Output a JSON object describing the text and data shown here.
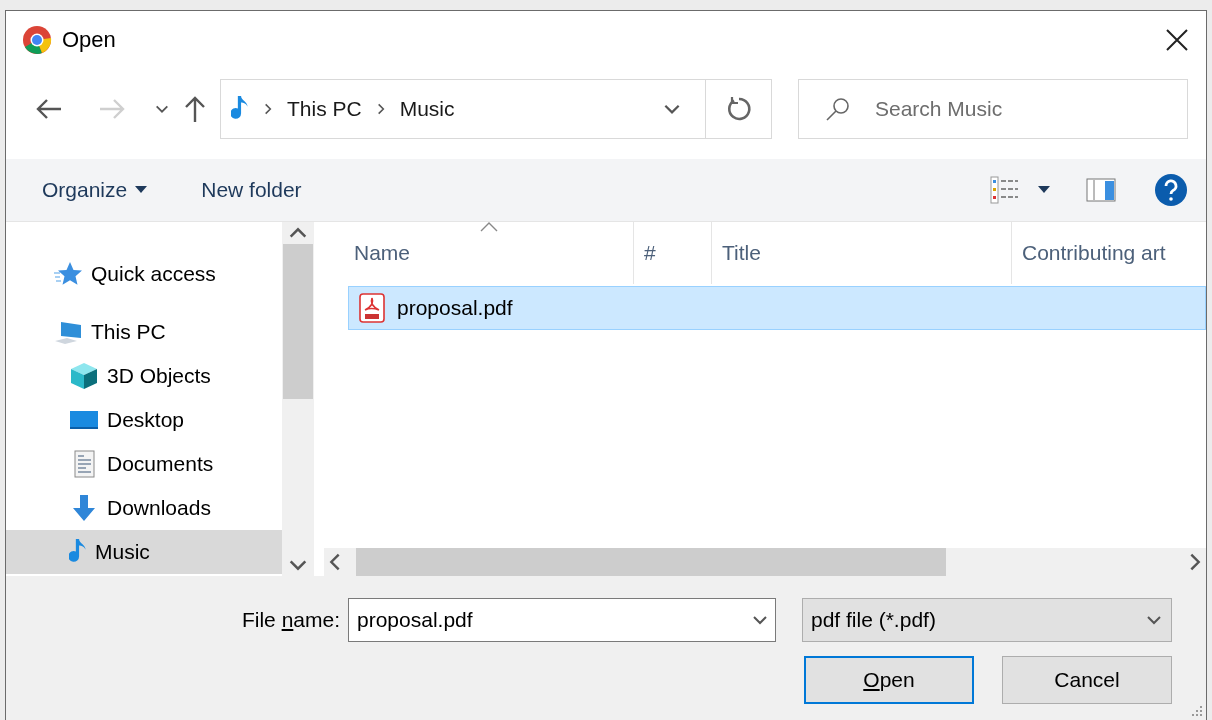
{
  "window": {
    "title": "Open"
  },
  "nav": {
    "buttons": [
      {
        "kind": "back",
        "disabled": false
      },
      {
        "kind": "forward",
        "disabled": true
      },
      {
        "kind": "recent",
        "disabled": false
      },
      {
        "kind": "up",
        "disabled": false
      }
    ],
    "breadcrumbs": [
      "This PC",
      "Music"
    ],
    "search": {
      "placeholder": "Search Music"
    }
  },
  "toolbar": {
    "organize": "Organize",
    "new_folder": "New folder"
  },
  "sidebar": {
    "items": [
      {
        "label": "Quick access",
        "kind": "star",
        "selected": false
      },
      {
        "label": "This PC",
        "kind": "computer",
        "selected": false,
        "children": [
          {
            "label": "3D Objects",
            "kind": "cube",
            "selected": false
          },
          {
            "label": "Desktop",
            "kind": "desktop",
            "selected": false
          },
          {
            "label": "Documents",
            "kind": "document",
            "selected": false
          },
          {
            "label": "Downloads",
            "kind": "download",
            "selected": false
          },
          {
            "label": "Music",
            "kind": "music",
            "selected": true
          }
        ]
      }
    ]
  },
  "table": {
    "columns": [
      {
        "label": "Name",
        "sorted": true
      },
      {
        "label": "#",
        "sorted": false
      },
      {
        "label": "Title",
        "sorted": false
      },
      {
        "label": "Contributing art",
        "sorted": false
      }
    ],
    "rows": [
      {
        "name": "proposal.pdf",
        "selected": true
      }
    ]
  },
  "footer": {
    "file_name": {
      "label_parts": [
        {
          "text": "File ",
          "underlined": false
        },
        {
          "text": "n",
          "underlined": true
        },
        {
          "text": "ame:",
          "underlined": false
        }
      ],
      "value": "proposal.pdf"
    },
    "file_type": "pdf file (*.pdf)",
    "buttons": [
      {
        "label_parts": [
          {
            "text": "O",
            "underlined": true
          },
          {
            "text": "pen",
            "underlined": false
          }
        ],
        "default": true
      },
      {
        "label_parts": [
          {
            "text": "Cancel",
            "underlined": false
          }
        ],
        "default": false
      }
    ]
  }
}
